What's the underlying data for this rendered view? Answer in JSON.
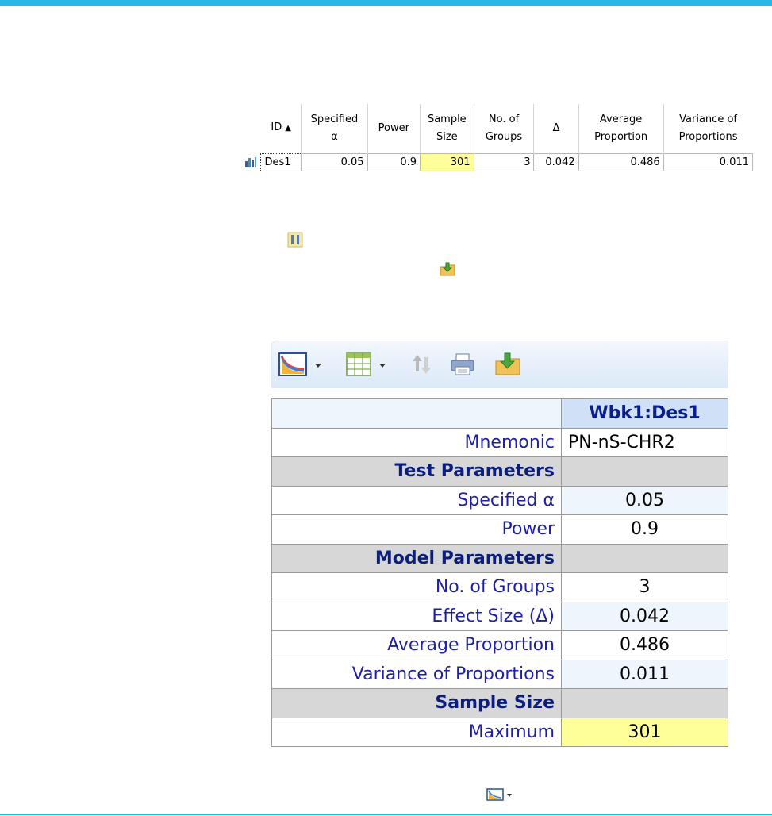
{
  "output_grid": {
    "columns": [
      {
        "label": "ID",
        "sort": "ascending"
      },
      {
        "label": "Specified\nα"
      },
      {
        "label": "Power"
      },
      {
        "label": "Sample\nSize"
      },
      {
        "label": "No. of\nGroups"
      },
      {
        "label": "Δ"
      },
      {
        "label": "Average\nProportion"
      },
      {
        "label": "Variance of\nProportions"
      }
    ],
    "rows": [
      {
        "id": "Des1",
        "specified_alpha": "0.05",
        "power": "0.9",
        "sample_size": "301",
        "groups": "3",
        "delta": "0.042",
        "average_proportion": "0.486",
        "variance": "0.011"
      }
    ]
  },
  "design_table": {
    "header": "Wbk1:Des1",
    "rows": [
      {
        "type": "data",
        "label": "Mnemonic",
        "value": "PN-nS-CHR2"
      },
      {
        "type": "section",
        "label": "Test Parameters"
      },
      {
        "type": "data",
        "label": "Specified α",
        "value": "0.05"
      },
      {
        "type": "data",
        "label": "Power",
        "value": "0.9"
      },
      {
        "type": "section",
        "label": "Model Parameters"
      },
      {
        "type": "data",
        "label": "No. of Groups",
        "value": "3"
      },
      {
        "type": "data",
        "label": "Effect Size (Δ)",
        "value": "0.042"
      },
      {
        "type": "data",
        "label": "Average Proportion",
        "value": "0.486"
      },
      {
        "type": "data",
        "label": "Variance of Proportions",
        "value": "0.011"
      },
      {
        "type": "section",
        "label": "Sample Size"
      },
      {
        "type": "data",
        "label": "Maximum",
        "value": "301"
      }
    ]
  },
  "toolbar": {
    "items": [
      "plot-icon",
      "table-icon",
      "sort-icon",
      "print-icon",
      "save-icon"
    ]
  },
  "colors": {
    "accent": "#2bb6e8",
    "highlight": "#ffff99",
    "label_blue": "#1e1eaa",
    "section_gray": "#d7d7d7"
  }
}
